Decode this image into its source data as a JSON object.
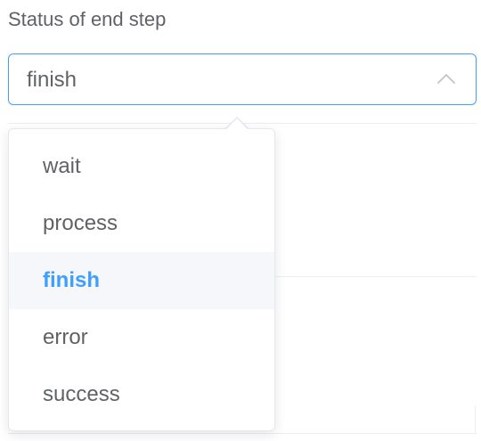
{
  "field": {
    "label": "Status of end step",
    "value": "finish",
    "chevron_icon": "chevron-up-icon"
  },
  "dropdown": {
    "options": [
      {
        "label": "wait",
        "selected": false
      },
      {
        "label": "process",
        "selected": false
      },
      {
        "label": "finish",
        "selected": true
      },
      {
        "label": "error",
        "selected": false
      },
      {
        "label": "success",
        "selected": false
      }
    ]
  },
  "colors": {
    "accent": "#409eff",
    "text": "#606266",
    "selected_bg": "#f5f7fa",
    "border": "#e4e7ed"
  }
}
